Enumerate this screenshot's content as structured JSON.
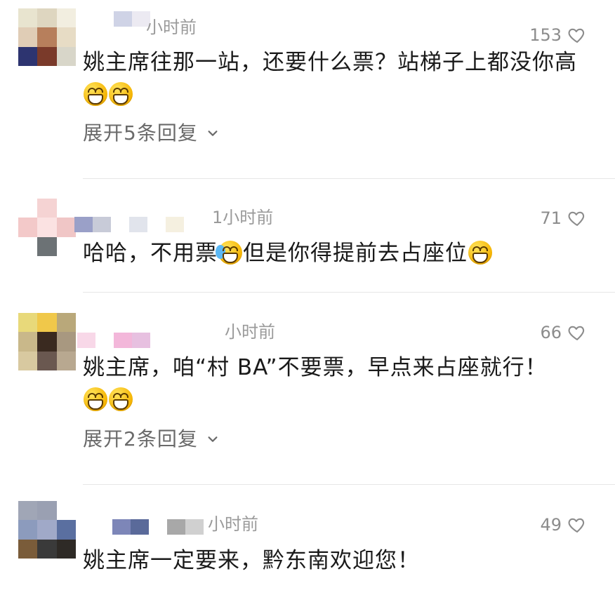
{
  "comments": [
    {
      "time": "小时前",
      "likes": "153",
      "text": "姚主席往那一站，还要什么票？站梯子上都没你高",
      "emoji_after": "😁😁",
      "expand_label": "展开5条回复",
      "avatar_colors": [
        "#e8e4cf",
        "#ded6c0",
        "#f2eee0",
        "#e0cdb6",
        "#b77f5c",
        "#e7dcc5",
        "#2d3470",
        "#7a3a2a",
        "#d8d6c9"
      ],
      "name_blur_colors": [
        "#cfd3e6",
        "#eceaf2"
      ]
    },
    {
      "time": "1小时前",
      "likes": "71",
      "text_before": "哈哈，不用票",
      "emoji_mid": "😭",
      "text_after": "但是你得提前去占座位",
      "emoji_after": "😁",
      "avatar_colors": [
        "#ffffff",
        "#f5d3d3",
        "#ffffff",
        "#f3c9c9",
        "#fbe2e2",
        "#f0c6c6",
        "#ffffff",
        "#6c7275",
        "#ffffff"
      ],
      "name_blur_colors": [
        "#9aa0c8",
        "#c8cbd8",
        "#ffffff",
        "#e1e4ec",
        "#ffffff",
        "#f5f0e0"
      ]
    },
    {
      "time": "小时前",
      "likes": "66",
      "text": "姚主席，咱“村 BA”不要票，早点来占座就行！",
      "emoji_after": "😁😁",
      "expand_label": "展开2条回复",
      "avatar_colors": [
        "#e8d97a",
        "#f0c84a",
        "#b9a87a",
        "#c9b88a",
        "#3a2a20",
        "#a89880",
        "#d8c9a0",
        "#6a5850",
        "#b8a890"
      ],
      "name_blur_colors": [
        "#f8d8e8",
        "#ffffff",
        "#f3b7da",
        "#e7c0e0"
      ]
    },
    {
      "time": "小时前",
      "likes": "49",
      "text": "姚主席一定要来，黔东南欢迎您！",
      "avatar_colors": [
        "#a0a6b6",
        "#9aa0b2",
        "#ffffff",
        "#8c9bbd",
        "#a0a9c8",
        "#5a6fa0",
        "#7a5c3a",
        "#3a3a3a",
        "#2e2a26"
      ],
      "name_blur_colors": [
        "#7d86b8",
        "#5a6a9a",
        "#ffffff",
        "#a8a8a8",
        "#d0d0d0"
      ]
    }
  ]
}
